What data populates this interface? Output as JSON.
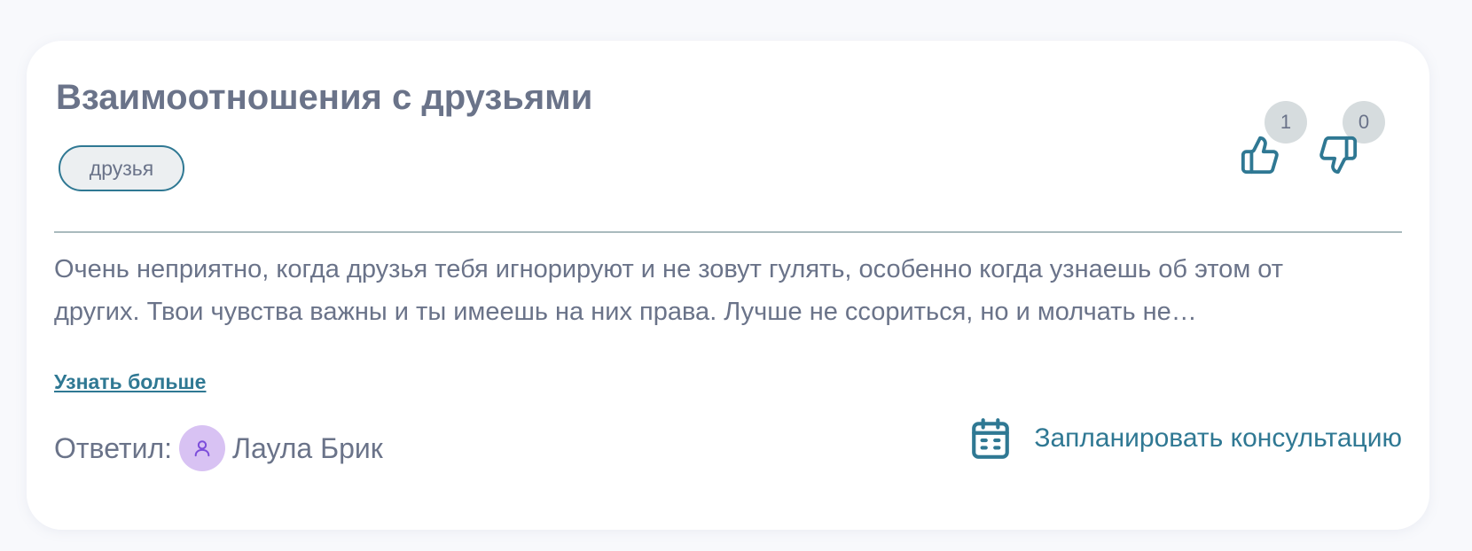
{
  "question": {
    "title": "Взаимоотношения с друзьями",
    "tag": "друзья",
    "likes": "1",
    "dislikes": "0",
    "excerpt": "Очень неприятно, когда друзья тебя игнорируют и не зовут гулять, особенно когда узнаешь об этом от других. Твои чувства важны и ты имеешь на них права. Лучше не ссориться, но и молчать не…",
    "more_label": "Узнать больше",
    "answered_label": "Ответил:",
    "author_name": "Лаула Брик",
    "schedule_label": "Запланировать консультацию"
  },
  "icons": {
    "like": "thumbs-up-icon",
    "dislike": "thumbs-down-icon",
    "avatar": "user-icon",
    "schedule": "calendar-icon"
  },
  "colors": {
    "accent": "#2f7893",
    "text": "#6a7389",
    "avatar_bg": "#d8c2f3",
    "avatar_icon": "#7c4ddb",
    "badge_bg": "#d6dcde",
    "divider": "#a9babd"
  }
}
